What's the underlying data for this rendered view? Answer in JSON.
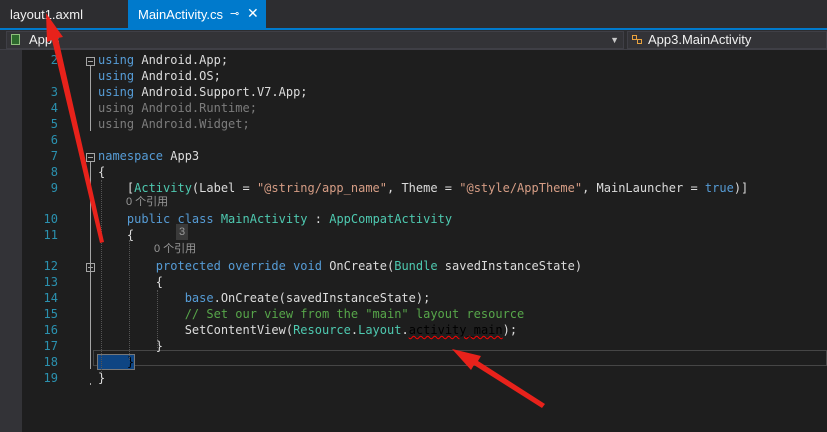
{
  "tabs": [
    {
      "label": "layout1.axml"
    },
    {
      "label": "MainActivity.cs",
      "pin_icon": "pin-icon",
      "close_icon": "close-icon"
    }
  ],
  "nav": {
    "project": "App3",
    "member": "App3.MainActivity"
  },
  "lines": [
    {
      "n": "2",
      "tokens": [
        [
          "using ",
          "kw"
        ],
        [
          "Android.App;",
          "pl"
        ]
      ]
    },
    {
      "n": "",
      "tokens": [
        [
          "using ",
          "kw"
        ],
        [
          "Android.OS;",
          "pl"
        ]
      ]
    },
    {
      "n": "3",
      "tokens": [
        [
          "using ",
          "kw"
        ],
        [
          "Android.Support.V7.App;",
          "pl"
        ]
      ]
    },
    {
      "n": "4",
      "tokens": [
        [
          "using ",
          "dim"
        ],
        [
          "Android.Runtime;",
          "dim"
        ]
      ]
    },
    {
      "n": "5",
      "tokens": [
        [
          "using ",
          "dim"
        ],
        [
          "Android.Widget;",
          "dim"
        ]
      ]
    },
    {
      "n": "6",
      "tokens": []
    },
    {
      "n": "7",
      "tokens": [
        [
          "namespace ",
          "kw"
        ],
        [
          "App3",
          "pl"
        ]
      ]
    },
    {
      "n": "8",
      "tokens": [
        [
          "{",
          "pl"
        ]
      ]
    },
    {
      "n": "9",
      "tokens": [
        [
          "    [",
          "pl"
        ],
        [
          "Activity",
          "ty"
        ],
        [
          "(Label = ",
          "pl"
        ],
        [
          "\"@string/app_name\"",
          "str"
        ],
        [
          ", Theme = ",
          "pl"
        ],
        [
          "\"@style/AppTheme\"",
          "str"
        ],
        [
          ", MainLauncher = ",
          "pl"
        ],
        [
          "true",
          "kw"
        ],
        [
          ")]",
          "pl"
        ]
      ]
    },
    {
      "n": "10",
      "tokens": [
        [
          "    public class ",
          "kw"
        ],
        [
          "MainActivity",
          "ty"
        ],
        [
          " : ",
          "pl"
        ],
        [
          "AppCompatActivity",
          "ty"
        ]
      ]
    },
    {
      "n": "11",
      "tokens": [
        [
          "    {",
          "pl"
        ]
      ]
    },
    {
      "n": "12",
      "tokens": [
        [
          "        protected override void ",
          "kw"
        ],
        [
          "OnCreate(",
          "pl"
        ],
        [
          "Bundle",
          "ty"
        ],
        [
          " savedInstanceState)",
          "pl"
        ]
      ]
    },
    {
      "n": "13",
      "tokens": [
        [
          "        {",
          "pl"
        ]
      ]
    },
    {
      "n": "14",
      "tokens": [
        [
          "            base",
          "kw"
        ],
        [
          ".OnCreate(savedInstanceState);",
          "pl"
        ]
      ]
    },
    {
      "n": "15",
      "tokens": [
        [
          "            // Set our view from the \"main\" layout resource",
          "cm"
        ]
      ]
    },
    {
      "n": "16",
      "tokens": [
        [
          "            SetContentView(",
          "pl"
        ],
        [
          "Resource",
          "ty"
        ],
        [
          ".",
          "pl"
        ],
        [
          "Layout",
          "ty"
        ],
        [
          ".",
          "pl"
        ],
        [
          "activity_main",
          "squig"
        ],
        [
          ");",
          "pl"
        ]
      ]
    },
    {
      "n": "17",
      "tokens": [
        [
          "        }",
          "pl"
        ]
      ]
    },
    {
      "n": "18",
      "tokens": [
        [
          "    }",
          "brace"
        ]
      ]
    },
    {
      "n": "19",
      "tokens": [
        [
          "}",
          "pl"
        ]
      ]
    }
  ],
  "lens": [
    {
      "text": "0 个引用"
    },
    {
      "text": "0 个引用"
    }
  ],
  "hint": "3",
  "colors": {
    "accent": "#007acc",
    "keyword": "#569cd6",
    "type": "#4ec9b0",
    "string": "#d69d85",
    "comment": "#57a64a",
    "arrow": "#e8221b"
  }
}
